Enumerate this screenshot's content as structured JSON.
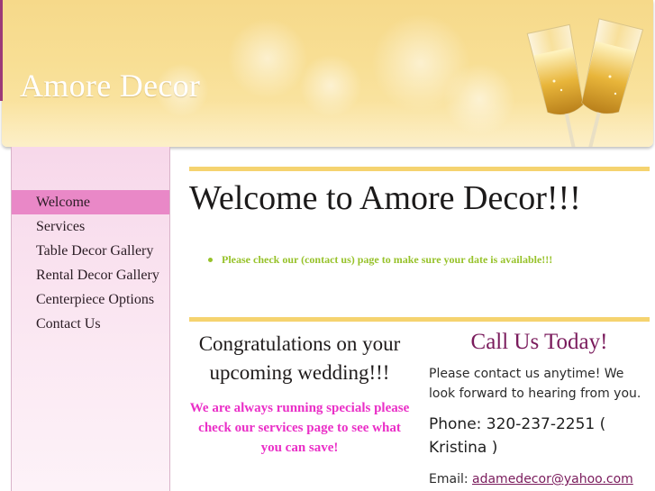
{
  "header": {
    "site_title": "Amore Decor"
  },
  "nav": [
    {
      "label": "Welcome",
      "active": true
    },
    {
      "label": "Services"
    },
    {
      "label": "Table Decor Gallery"
    },
    {
      "label": "Rental Decor Gallery"
    },
    {
      "label": "Centerpiece Options"
    },
    {
      "label": "Contact Us"
    }
  ],
  "main": {
    "title": "Welcome to Amore Decor!!!",
    "notice": "Please check our (contact us) page to make sure your date is available!!!",
    "congrats": "Congratulations on your upcoming wedding!!!",
    "specials": "We are always running specials please check our services page to see what you can save!"
  },
  "contact": {
    "title": "Call Us Today!",
    "text": "Please contact us anytime! We look forward to hearing from you.",
    "phone": "Phone: 320-237-2251 ( Kristina )",
    "email_label": "Email:",
    "email": "adamedecor@yahoo.com"
  },
  "colors": {
    "header_gold": "#f8df95",
    "nav_active": "#e988c7",
    "rule_gold": "#f5d36f",
    "notice_green": "#97c22a",
    "specials_pink": "#ea2fc7",
    "call_title": "#7a1b5c"
  }
}
